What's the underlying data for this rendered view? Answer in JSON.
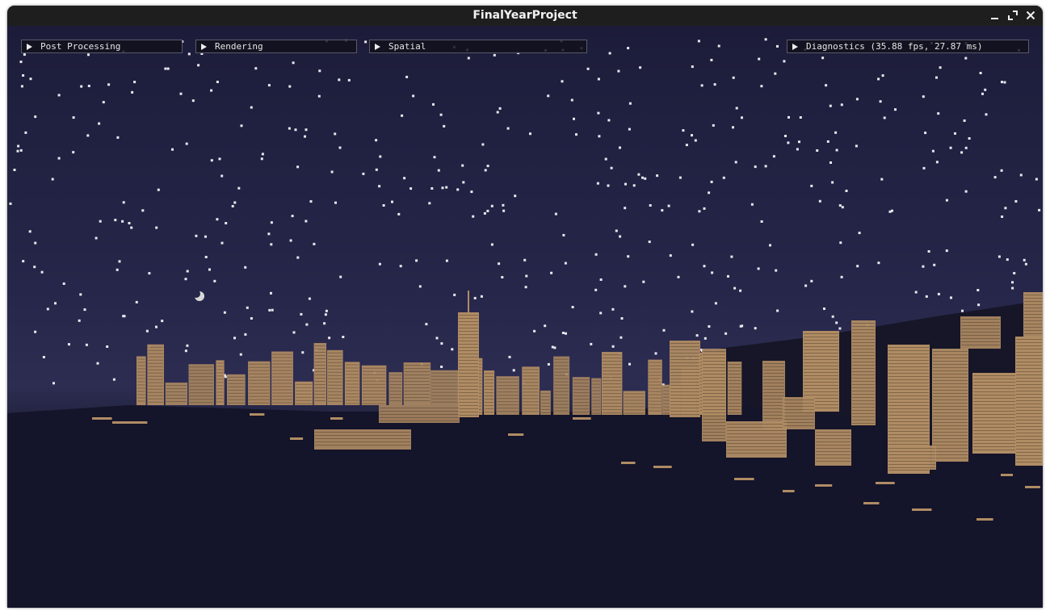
{
  "window": {
    "title": "FinalYearProject",
    "controls": {
      "minimize": "minimize-icon",
      "maximize": "maximize-icon",
      "close": "close-icon"
    }
  },
  "panels": [
    {
      "label": "Post Processing",
      "icon": "expand-arrow-icon"
    },
    {
      "label": "Rendering",
      "icon": "expand-arrow-icon"
    },
    {
      "label": "Spatial",
      "icon": "expand-arrow-icon"
    },
    {
      "label": "Diagnostics (35.88 fps, 27.87 ms)",
      "icon": "expand-arrow-icon"
    }
  ],
  "scene": {
    "sky_color": "#24244a",
    "ground_color": "#12121f",
    "building_color": "#b08c64",
    "star_color": "#e8e8f0"
  }
}
